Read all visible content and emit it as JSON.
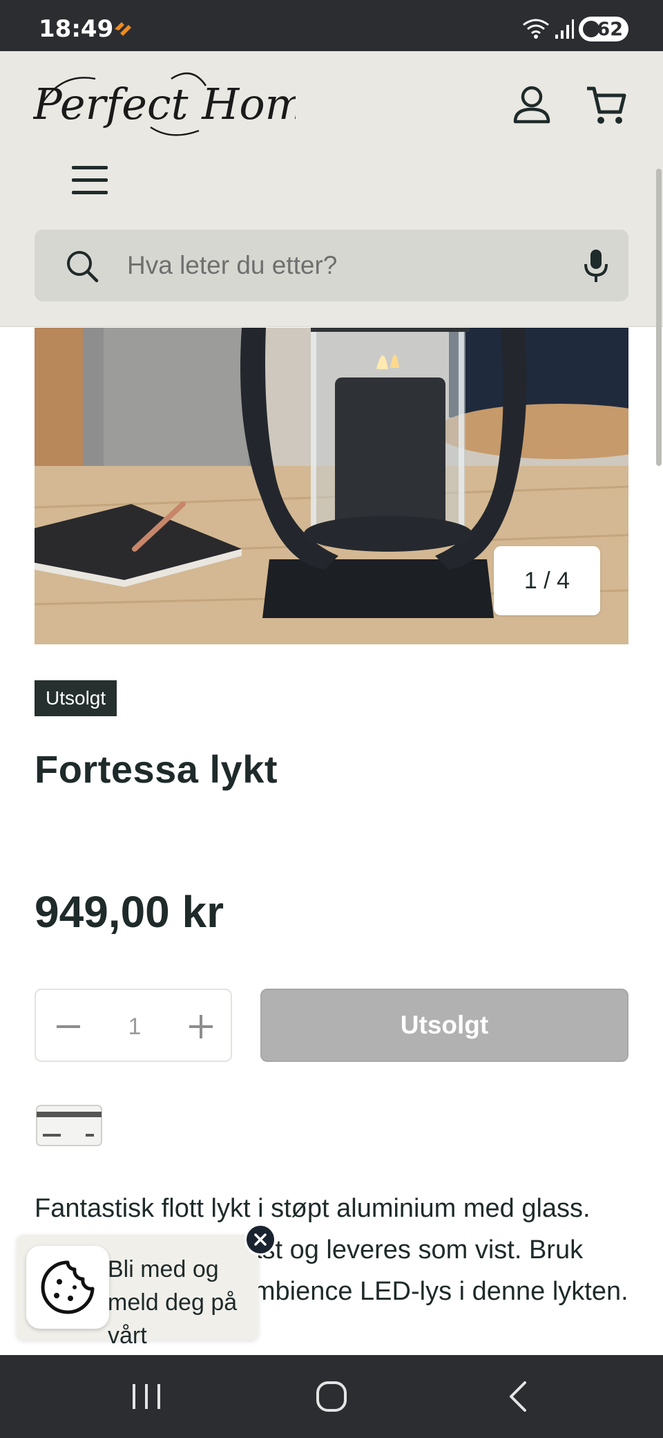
{
  "status_bar": {
    "time": "18:49",
    "battery": "62",
    "icons": [
      "app-notification-icon",
      "wifi-icon",
      "signal-icon",
      "battery-icon"
    ]
  },
  "header": {
    "logo_text": "Perfect Home",
    "icons": [
      "account-icon",
      "cart-icon",
      "menu-icon"
    ]
  },
  "search": {
    "placeholder": "Hva leter du etter?",
    "value": "",
    "icons": [
      "search-icon",
      "microphone-icon"
    ]
  },
  "product": {
    "image_counter": "1 / 4",
    "badge": "Utsolgt",
    "title": "Fortessa lykt",
    "price": "949,00 kr",
    "quantity": "1",
    "buy_button_label": "Utsolgt",
    "description": "Fantastisk flott lykt i støpt aluminium med glass. Glasset er munnblåst og leveres som vist. Bruk gjerne et av våre Ambience LED-lys i denne lykten."
  },
  "newsletter_popup": {
    "text": "Bli med og meld deg på vårt nyhetsbrev!",
    "visible_text": "ner på vårt\nnetsbrev!"
  },
  "colors": {
    "header_bg": "#e9e8e2",
    "search_bg": "#d7d7d2",
    "badge_bg": "#25302f",
    "disabled_button": "#b0b1b0",
    "system_bar": "#2b2d31"
  }
}
